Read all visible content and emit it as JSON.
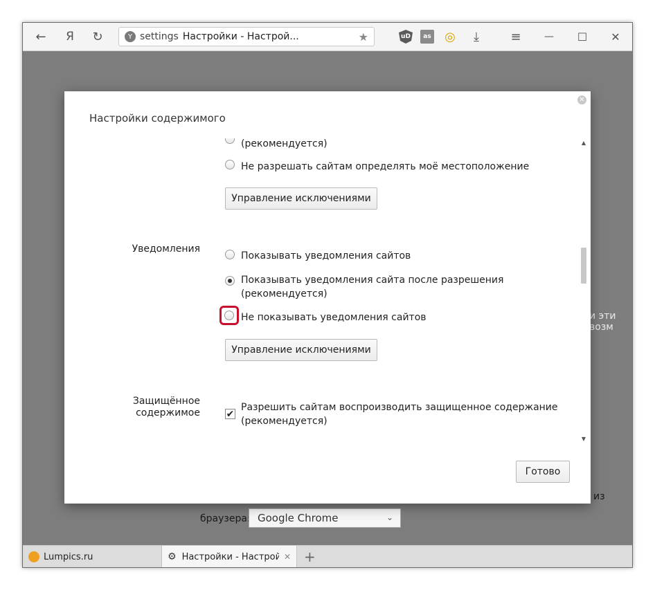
{
  "toolbar": {
    "back_icon": "←",
    "yandex_letter": "Я",
    "reload_icon": "↻",
    "omnibox": {
      "host": "settings",
      "title": "Настройки - Настрой...",
      "star": "★"
    },
    "extensions": [
      {
        "name": "ublock-icon",
        "text": "uD",
        "color": "#5a5a5a"
      },
      {
        "name": "lastfm-icon",
        "text": "as",
        "color": "#8a8a8a"
      },
      {
        "name": "target-icon",
        "text": "◎",
        "color": "#e0a000"
      }
    ],
    "download_icon": "⤓",
    "menu_icon": "≡",
    "minimize_icon": "—",
    "maximize_icon": "☐",
    "close_icon": "✕"
  },
  "background": {
    "right_fragment_1": "и эти возм",
    "right_fragment_2": "из",
    "browser_label": "браузера:",
    "browser_select": "Google Chrome"
  },
  "dialog": {
    "title": "Настройки содержимого",
    "close_icon": "✕",
    "location": {
      "recommended_tail": "(рекомендуется)",
      "deny_label": "Не разрешать сайтам определять моё местоположение",
      "exceptions_button": "Управление исключениями"
    },
    "notifications": {
      "label": "Уведомления",
      "options": [
        "Показывать уведомления сайтов",
        "Показывать уведомления сайта после разрешения",
        "Не показывать уведомления сайтов"
      ],
      "option2_tail": "(рекомендуется)",
      "selected_index": 1,
      "exceptions_button": "Управление исключениями"
    },
    "protected": {
      "label_line1": "Защищённое",
      "label_line2": "содержимое",
      "checkbox_label": "Разрешить сайтам воспроизводить защищенное содержание",
      "checkbox_tail": "(рекомендуется)",
      "checked": true
    },
    "done_button": "Готово"
  },
  "tabs": [
    {
      "title": "Lumpics.ru",
      "active": false
    },
    {
      "title": "Настройки - Настройки",
      "active": true
    }
  ],
  "new_tab_icon": "+",
  "tab_close_icon": "✕"
}
